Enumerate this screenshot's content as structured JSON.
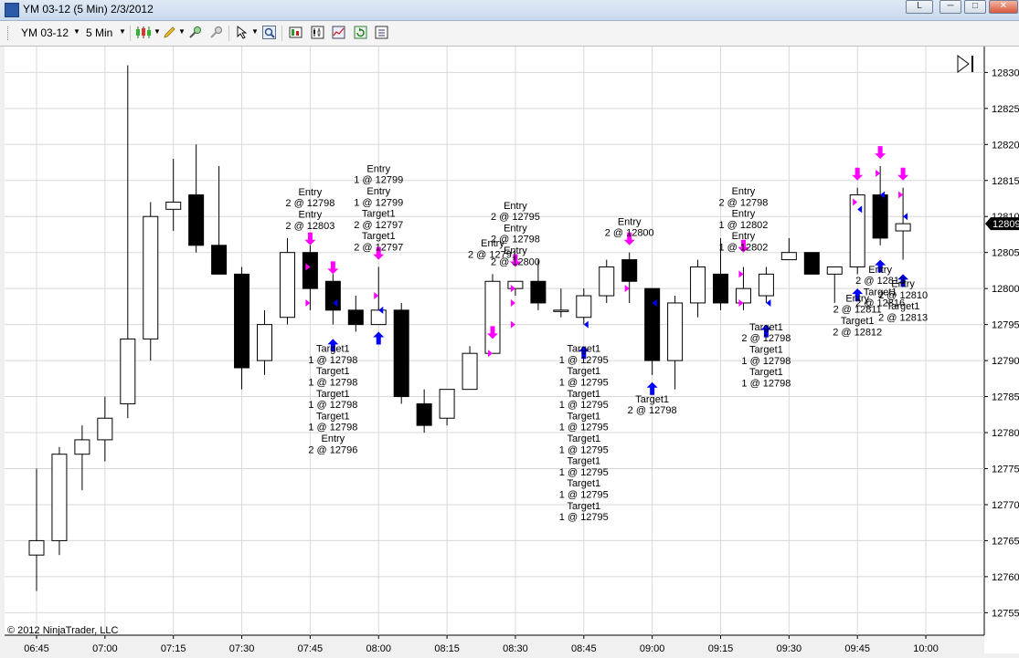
{
  "window": {
    "title": "YM 03-12 (5 Min)  2/3/2012",
    "right_button_label": "L"
  },
  "toolbar": {
    "instrument": "YM 03-12",
    "interval": "5 Min",
    "icons": [
      "candlestick-style-icon",
      "drawing-pencil-icon",
      "zoom-in-icon",
      "zoom-out-icon",
      "cursor-select-icon",
      "magnifier-icon",
      "strategies-icon",
      "indicators-icon",
      "chart-trader-icon",
      "refresh-icon",
      "properties-icon"
    ]
  },
  "copyright": "© 2012 NinjaTrader, LLC",
  "price_marker": "12809",
  "chart_data": {
    "type": "candlestick",
    "x_tick_labels": [
      "06:45",
      "07:00",
      "07:15",
      "07:30",
      "07:45",
      "08:00",
      "08:15",
      "08:30",
      "08:45",
      "09:00",
      "09:15",
      "09:30",
      "09:45",
      "10:00"
    ],
    "y_ticks": [
      12755,
      12760,
      12765,
      12770,
      12775,
      12780,
      12785,
      12790,
      12795,
      12800,
      12805,
      12810,
      12815,
      12820,
      12825,
      12830
    ],
    "ylim": [
      12753,
      12831
    ],
    "grid": true,
    "colors": {
      "up_fill": "#ffffff",
      "down_fill": "#000000",
      "entry_arrow": "#ff00ff",
      "exit_arrow": "#0000ff",
      "marker": "#000000"
    },
    "bars": [
      {
        "time": "06:45",
        "open": 12763,
        "high": 12775,
        "low": 12758,
        "close": 12765
      },
      {
        "time": "06:50",
        "open": 12765,
        "high": 12778,
        "low": 12763,
        "close": 12777
      },
      {
        "time": "06:55",
        "open": 12777,
        "high": 12781,
        "low": 12772,
        "close": 12779
      },
      {
        "time": "07:00",
        "open": 12779,
        "high": 12785,
        "low": 12776,
        "close": 12782
      },
      {
        "time": "07:05",
        "open": 12784,
        "high": 12831,
        "low": 12782,
        "close": 12793
      },
      {
        "time": "07:10",
        "open": 12793,
        "high": 12812,
        "low": 12790,
        "close": 12810
      },
      {
        "time": "07:15",
        "open": 12811,
        "high": 12818,
        "low": 12808,
        "close": 12812
      },
      {
        "time": "07:20",
        "open": 12813,
        "high": 12820,
        "low": 12805,
        "close": 12806
      },
      {
        "time": "07:25",
        "open": 12806,
        "high": 12817,
        "low": 12802,
        "close": 12802
      },
      {
        "time": "07:30",
        "open": 12802,
        "high": 12803,
        "low": 12786,
        "close": 12789
      },
      {
        "time": "07:35",
        "open": 12790,
        "high": 12797,
        "low": 12788,
        "close": 12795
      },
      {
        "time": "07:40",
        "open": 12796,
        "high": 12807,
        "low": 12795,
        "close": 12805
      },
      {
        "time": "07:45",
        "open": 12805,
        "high": 12806,
        "low": 12797,
        "close": 12800
      },
      {
        "time": "07:50",
        "open": 12801,
        "high": 12802,
        "low": 12795,
        "close": 12797
      },
      {
        "time": "07:55",
        "open": 12797,
        "high": 12799,
        "low": 12794,
        "close": 12795
      },
      {
        "time": "08:00",
        "open": 12795,
        "high": 12803,
        "low": 12795,
        "close": 12797
      },
      {
        "time": "08:05",
        "open": 12797,
        "high": 12798,
        "low": 12784,
        "close": 12785
      },
      {
        "time": "08:10",
        "open": 12784,
        "high": 12786,
        "low": 12780,
        "close": 12781
      },
      {
        "time": "08:15",
        "open": 12782,
        "high": 12786,
        "low": 12781,
        "close": 12786
      },
      {
        "time": "08:20",
        "open": 12786,
        "high": 12792,
        "low": 12786,
        "close": 12791
      },
      {
        "time": "08:25",
        "open": 12791,
        "high": 12802,
        "low": 12791,
        "close": 12801
      },
      {
        "time": "08:30",
        "open": 12800,
        "high": 12801,
        "low": 12799,
        "close": 12801
      },
      {
        "time": "08:35",
        "open": 12801,
        "high": 12804,
        "low": 12797,
        "close": 12798
      },
      {
        "time": "08:40",
        "open": 12797,
        "high": 12800,
        "low": 12796,
        "close": 12797
      },
      {
        "time": "08:45",
        "open": 12796,
        "high": 12800,
        "low": 12795,
        "close": 12799
      },
      {
        "time": "08:50",
        "open": 12799,
        "high": 12804,
        "low": 12798,
        "close": 12803
      },
      {
        "time": "08:55",
        "open": 12804,
        "high": 12805,
        "low": 12798,
        "close": 12801
      },
      {
        "time": "09:00",
        "open": 12800,
        "high": 12800,
        "low": 12788,
        "close": 12790
      },
      {
        "time": "09:05",
        "open": 12790,
        "high": 12799,
        "low": 12786,
        "close": 12798
      },
      {
        "time": "09:10",
        "open": 12798,
        "high": 12804,
        "low": 12796,
        "close": 12803
      },
      {
        "time": "09:15",
        "open": 12802,
        "high": 12807,
        "low": 12797,
        "close": 12798
      },
      {
        "time": "09:20",
        "open": 12798,
        "high": 12803,
        "low": 12797,
        "close": 12800
      },
      {
        "time": "09:25",
        "open": 12799,
        "high": 12803,
        "low": 12798,
        "close": 12802
      },
      {
        "time": "09:30",
        "open": 12804,
        "high": 12807,
        "low": 12804,
        "close": 12805
      },
      {
        "time": "09:35",
        "open": 12805,
        "high": 12805,
        "low": 12802,
        "close": 12802
      },
      {
        "time": "09:40",
        "open": 12802,
        "high": 12803,
        "low": 12798,
        "close": 12803
      },
      {
        "time": "09:45",
        "open": 12803,
        "high": 12814,
        "low": 12802,
        "close": 12813
      },
      {
        "time": "09:50",
        "open": 12813,
        "high": 12817,
        "low": 12806,
        "close": 12807
      },
      {
        "time": "09:55",
        "open": 12808,
        "high": 12814,
        "low": 12804,
        "close": 12809
      }
    ],
    "annotations": [
      {
        "bar": 12,
        "side": "above",
        "lines": [
          "Entry",
          "2 @ 12798",
          "Entry",
          "2 @ 12803"
        ]
      },
      {
        "bar": 15,
        "side": "above",
        "lines": [
          "Entry",
          "1 @ 12799",
          "Entry",
          "1 @ 12799",
          "Target1",
          "2 @ 12797",
          "Target1",
          "2 @ 12797"
        ]
      },
      {
        "bar": 13,
        "side": "below",
        "lines": [
          "Target1",
          "1 @ 12798",
          "Target1",
          "1 @ 12798",
          "Target1",
          "1 @ 12798",
          "Target1",
          "1 @ 12798",
          "Entry",
          "2 @ 12796"
        ]
      },
      {
        "bar": 20,
        "side": "above",
        "lines": [
          "Entry",
          "2 @ 12791"
        ]
      },
      {
        "bar": 21,
        "side": "above",
        "lines": [
          "Entry",
          "2 @ 12795",
          "Entry",
          "2 @ 12798",
          "Entry",
          "2 @ 12800"
        ]
      },
      {
        "bar": 24,
        "side": "below",
        "lines": [
          "Target1",
          "1 @ 12795",
          "Target1",
          "1 @ 12795",
          "Target1",
          "1 @ 12795",
          "Target1",
          "1 @ 12795",
          "Target1",
          "1 @ 12795",
          "Target1",
          "1 @ 12795",
          "Target1",
          "1 @ 12795",
          "Target1",
          "1 @ 12795"
        ]
      },
      {
        "bar": 26,
        "side": "above",
        "lines": [
          "Entry",
          "2 @ 12800"
        ]
      },
      {
        "bar": 27,
        "side": "below",
        "lines": [
          "Target1",
          "2 @ 12798"
        ]
      },
      {
        "bar": 31,
        "side": "above",
        "lines": [
          "Entry",
          "2 @ 12798",
          "Entry",
          "1 @ 12802",
          "Entry",
          "1 @ 12802"
        ]
      },
      {
        "bar": 32,
        "side": "below",
        "lines": [
          "Target1",
          "2 @ 12798",
          "Target1",
          "1 @ 12798",
          "Target1",
          "1 @ 12798"
        ]
      },
      {
        "bar": 36,
        "side": "below",
        "lines": [
          "Entry",
          "2 @ 12811",
          "Target1",
          "2 @ 12812"
        ]
      },
      {
        "bar": 37,
        "side": "below",
        "lines": [
          "Entry",
          "2 @ 12813",
          "Target1",
          "2 @ 12816"
        ]
      },
      {
        "bar": 38,
        "side": "below",
        "lines": [
          "Entry",
          "2 @ 12810",
          "Target1",
          "2 @ 12813"
        ]
      }
    ],
    "entry_arrows": [
      {
        "bar": 12,
        "price": 12806
      },
      {
        "bar": 13,
        "price": 12802
      },
      {
        "bar": 15,
        "price": 12804
      },
      {
        "bar": 20,
        "price": 12793
      },
      {
        "bar": 21,
        "price": 12803
      },
      {
        "bar": 26,
        "price": 12806
      },
      {
        "bar": 31,
        "price": 12805
      },
      {
        "bar": 36,
        "price": 12815
      },
      {
        "bar": 37,
        "price": 12818
      },
      {
        "bar": 38,
        "price": 12815
      }
    ],
    "exit_arrows": [
      {
        "bar": 13,
        "price": 12793
      },
      {
        "bar": 15,
        "price": 12794
      },
      {
        "bar": 24,
        "price": 12792
      },
      {
        "bar": 27,
        "price": 12787
      },
      {
        "bar": 32,
        "price": 12795
      },
      {
        "bar": 36,
        "price": 12800
      },
      {
        "bar": 37,
        "price": 12804
      },
      {
        "bar": 38,
        "price": 12802
      }
    ],
    "fill_markers": [
      {
        "bar": 12,
        "price": 12803,
        "dir": "right",
        "color": "#ff00ff"
      },
      {
        "bar": 12,
        "price": 12798,
        "dir": "right",
        "color": "#ff00ff"
      },
      {
        "bar": 13,
        "price": 12798,
        "dir": "left",
        "color": "#0000ff"
      },
      {
        "bar": 15,
        "price": 12799,
        "dir": "right",
        "color": "#ff00ff"
      },
      {
        "bar": 15,
        "price": 12797,
        "dir": "left",
        "color": "#0000ff"
      },
      {
        "bar": 20,
        "price": 12791,
        "dir": "right",
        "color": "#ff00ff"
      },
      {
        "bar": 21,
        "price": 12800,
        "dir": "right",
        "color": "#ff00ff"
      },
      {
        "bar": 21,
        "price": 12798,
        "dir": "right",
        "color": "#ff00ff"
      },
      {
        "bar": 21,
        "price": 12795,
        "dir": "right",
        "color": "#ff00ff"
      },
      {
        "bar": 24,
        "price": 12795,
        "dir": "left",
        "color": "#0000ff"
      },
      {
        "bar": 26,
        "price": 12800,
        "dir": "right",
        "color": "#ff00ff"
      },
      {
        "bar": 27,
        "price": 12798,
        "dir": "left",
        "color": "#0000ff"
      },
      {
        "bar": 31,
        "price": 12802,
        "dir": "right",
        "color": "#ff00ff"
      },
      {
        "bar": 31,
        "price": 12798,
        "dir": "right",
        "color": "#ff00ff"
      },
      {
        "bar": 32,
        "price": 12798,
        "dir": "left",
        "color": "#0000ff"
      },
      {
        "bar": 36,
        "price": 12811,
        "dir": "left",
        "color": "#0000ff"
      },
      {
        "bar": 36,
        "price": 12812,
        "dir": "right",
        "color": "#ff00ff"
      },
      {
        "bar": 37,
        "price": 12816,
        "dir": "right",
        "color": "#ff00ff"
      },
      {
        "bar": 37,
        "price": 12813,
        "dir": "left",
        "color": "#0000ff"
      },
      {
        "bar": 38,
        "price": 12813,
        "dir": "right",
        "color": "#ff00ff"
      },
      {
        "bar": 38,
        "price": 12810,
        "dir": "left",
        "color": "#0000ff"
      }
    ]
  }
}
